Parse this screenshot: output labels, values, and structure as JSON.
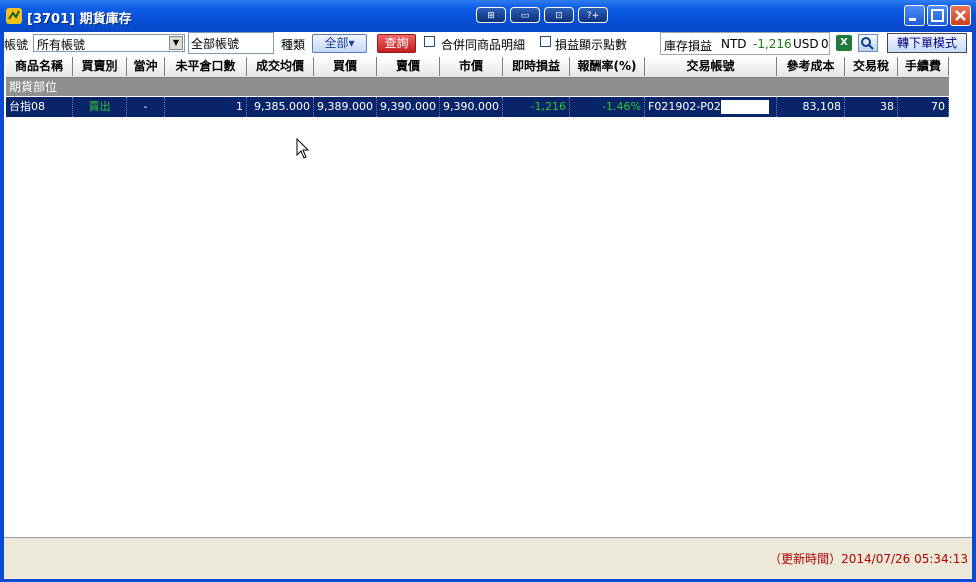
{
  "window": {
    "title": "[3701] 期貨庫存"
  },
  "title_buttons": [
    "⊞",
    "▭",
    "⊡",
    "?+"
  ],
  "toolbar": {
    "account_label": "帳號",
    "account_value": "所有帳號",
    "account_text": "全部帳號",
    "type_label": "種類",
    "all_button": "全部▾",
    "query_button": "查詢",
    "merge_label": "合併同商品明細",
    "points_label": "損益顯示點數",
    "pnl_label": "庫存損益",
    "pnl_ntd_label": "NTD",
    "pnl_ntd_value": "-1,216",
    "pnl_usd_label": "USD",
    "pnl_usd_value": "0",
    "switch_button": "轉下單模式"
  },
  "table": {
    "columns": [
      "商品名稱",
      "買賣別",
      "當沖",
      "未平倉口數",
      "成交均價",
      "買價",
      "賣價",
      "市價",
      "即時損益",
      "報酬率(%)",
      "交易帳號",
      "參考成本",
      "交易稅",
      "手續費"
    ],
    "group_label": "期貨部位",
    "rows": [
      {
        "product": "台指08",
        "side": "賣出",
        "daytrade": "-",
        "open_qty": "1",
        "avg_price": "9,385.000",
        "bid": "9,389.000",
        "ask": "9,390.000",
        "market": "9,390.000",
        "pnl": "-1,216",
        "return_pct": "-1.46%",
        "account": "F021902-P02",
        "ref_cost": "83,108",
        "tax": "38",
        "fee": "70"
      }
    ]
  },
  "footer": {
    "update_time": "（更新時間）2014/07/26 05:34:13"
  },
  "colors": {
    "title_bar": "#0a4ad6",
    "selected_row": "#0a246a",
    "group_row": "#8f8f8f",
    "profit_green": "#2ec52e",
    "update_red": "#b00000"
  }
}
